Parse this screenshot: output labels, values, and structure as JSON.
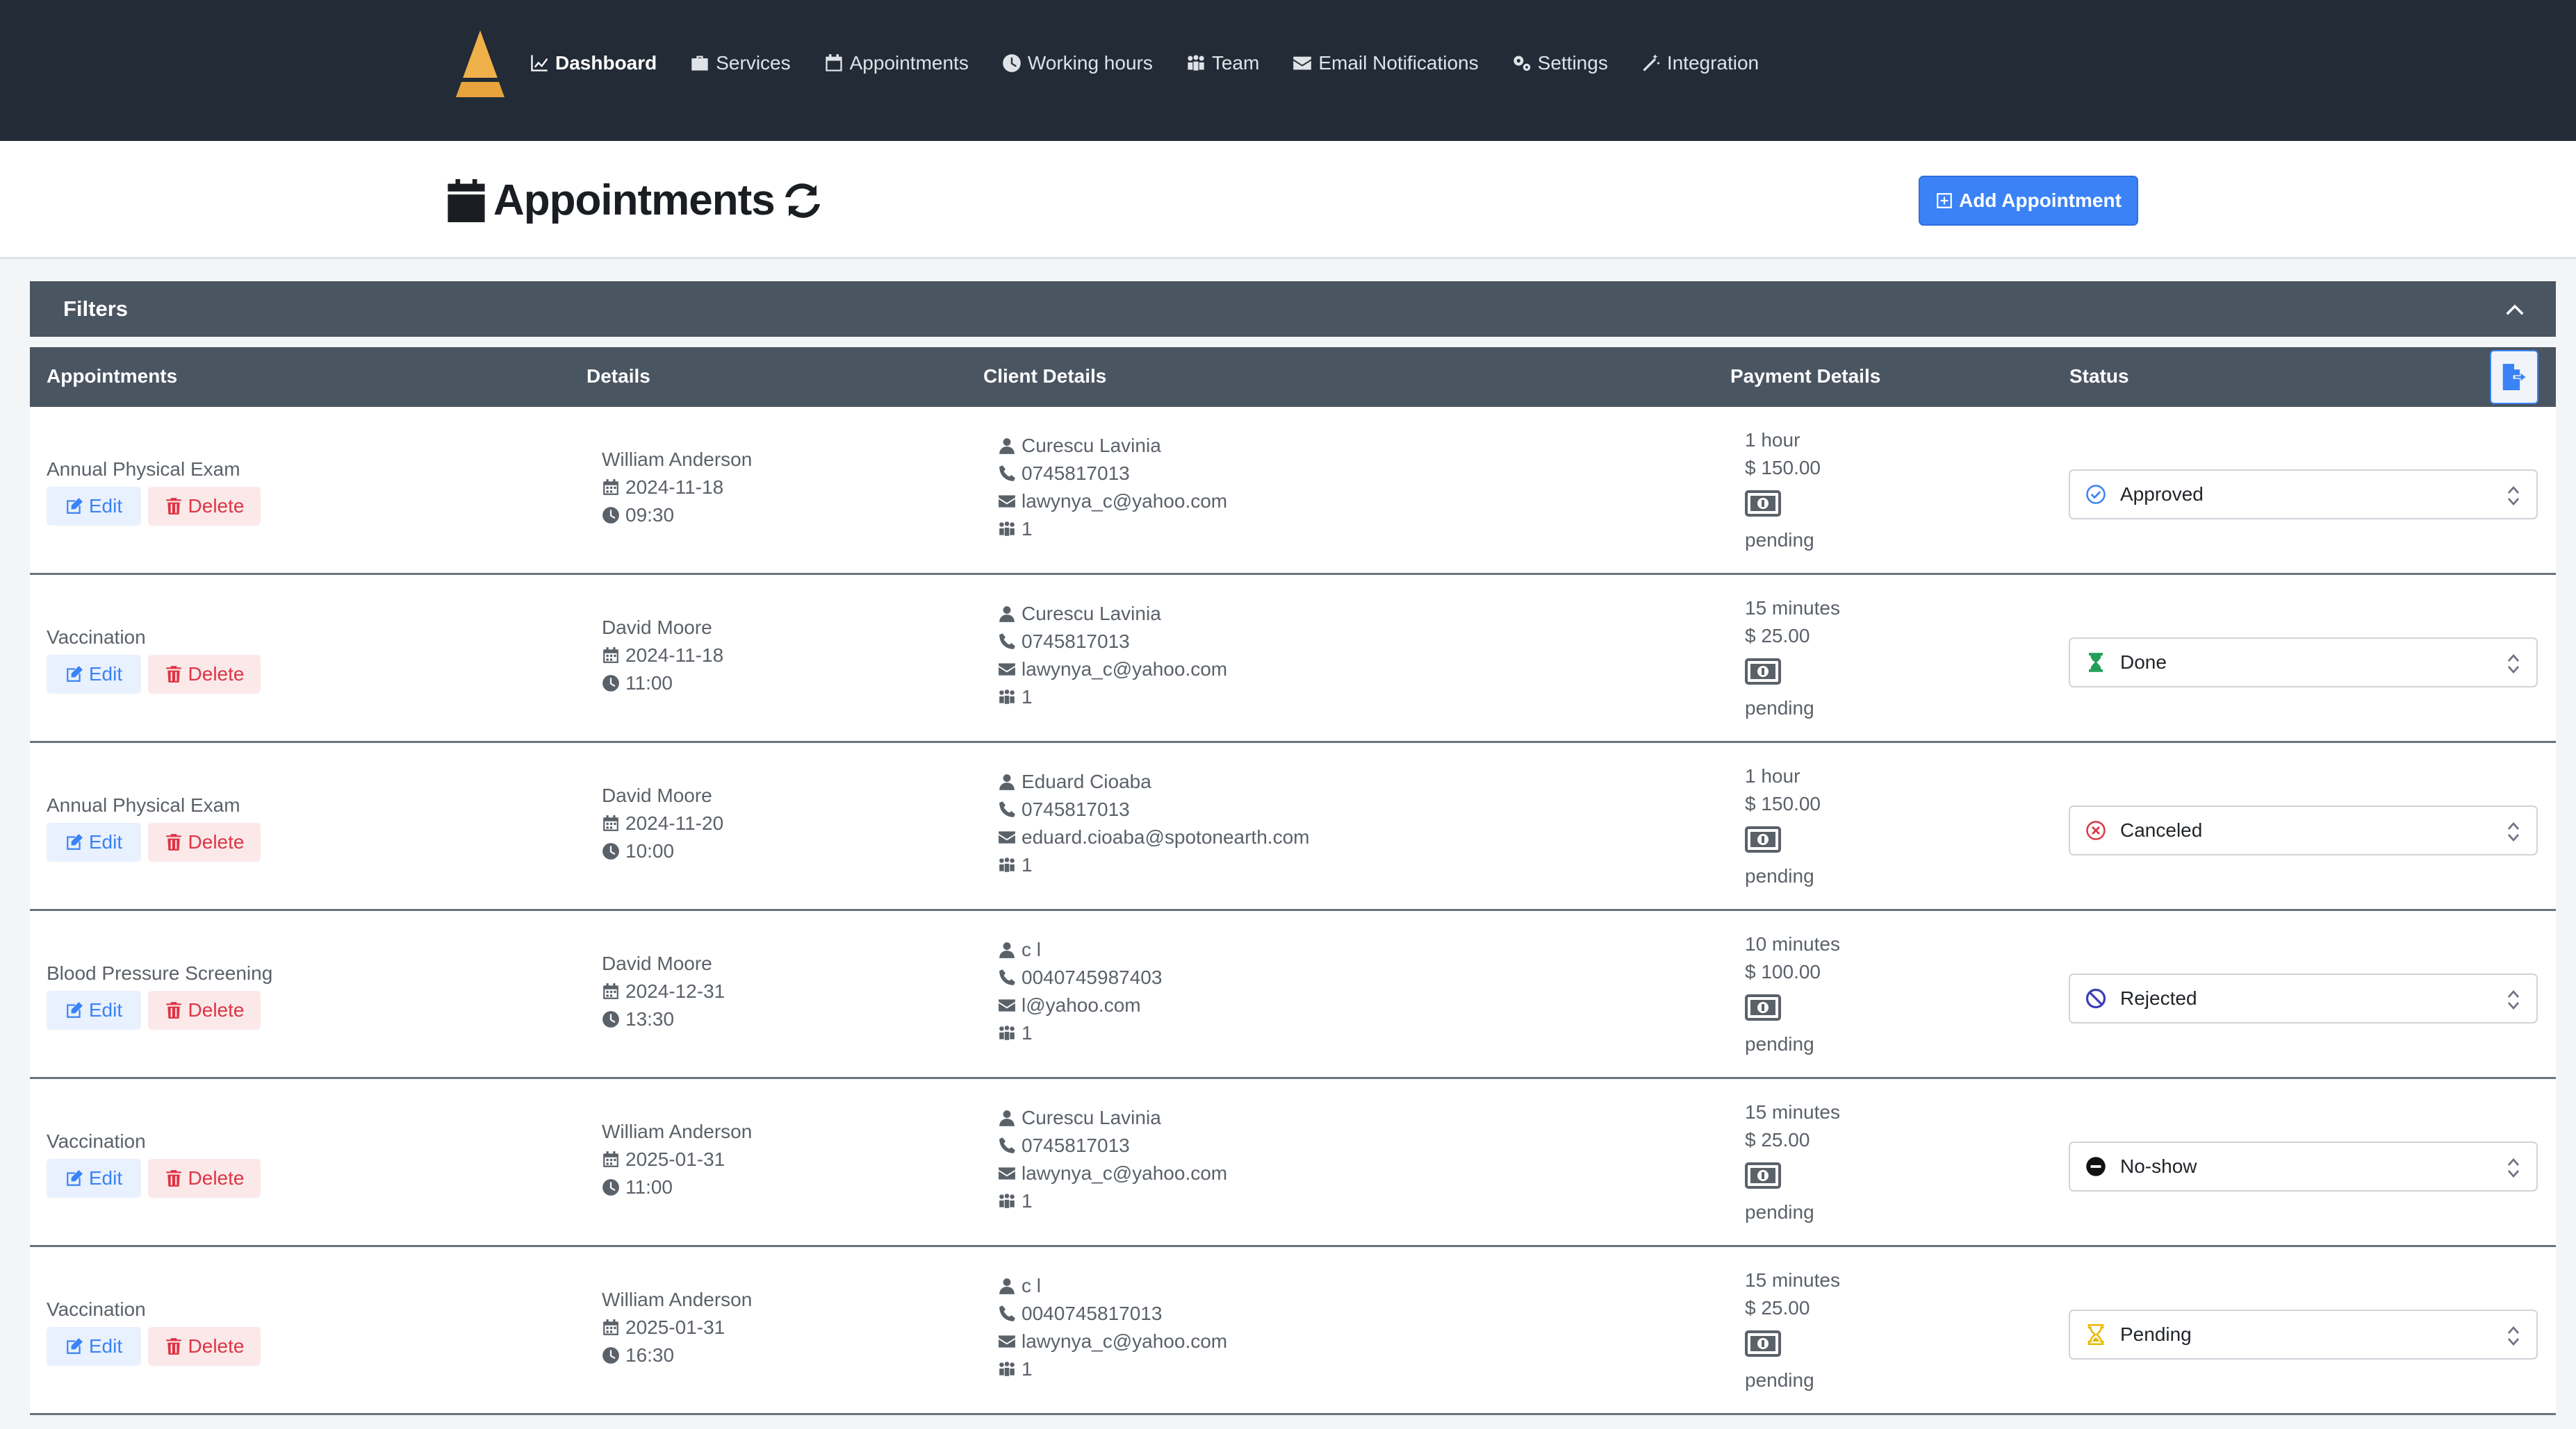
{
  "nav": {
    "items": [
      {
        "label": "Dashboard",
        "icon": "chart-line-icon",
        "active": true
      },
      {
        "label": "Services",
        "icon": "briefcase-icon",
        "active": false
      },
      {
        "label": "Appointments",
        "icon": "calendar-icon",
        "active": false
      },
      {
        "label": "Working hours",
        "icon": "clock-icon",
        "active": false
      },
      {
        "label": "Team",
        "icon": "people-group-icon",
        "active": false
      },
      {
        "label": "Email Notifications",
        "icon": "envelope-icon",
        "active": false
      },
      {
        "label": "Settings",
        "icon": "gears-icon",
        "active": false
      },
      {
        "label": "Integration",
        "icon": "magic-wand-icon",
        "active": false
      }
    ]
  },
  "header": {
    "title": "Appointments",
    "add_button_label": "Add Appointment"
  },
  "filters": {
    "label": "Filters"
  },
  "table": {
    "columns": [
      "Appointments",
      "Details",
      "Client Details",
      "Payment Details",
      "Status"
    ],
    "edit_label": "Edit",
    "delete_label": "Delete",
    "rows": [
      {
        "service": "Annual Physical Exam",
        "staff": "William Anderson",
        "date": "2024-11-18",
        "time": "09:30",
        "client_name": "Curescu Lavinia",
        "phone": "0745817013",
        "email": "lawynya_c@yahoo.com",
        "persons": "1",
        "duration": "1 hour",
        "price": "$ 150.00",
        "payment_status": "pending",
        "status": "Approved",
        "status_icon": "check-circle-icon"
      },
      {
        "service": "Vaccination",
        "staff": "David Moore",
        "date": "2024-11-18",
        "time": "11:00",
        "client_name": "Curescu Lavinia",
        "phone": "0745817013",
        "email": "lawynya_c@yahoo.com",
        "persons": "1",
        "duration": "15 minutes",
        "price": "$ 25.00",
        "payment_status": "pending",
        "status": "Done",
        "status_icon": "hourglass-end-icon"
      },
      {
        "service": "Annual Physical Exam",
        "staff": "David Moore",
        "date": "2024-11-20",
        "time": "10:00",
        "client_name": "Eduard Cioaba",
        "phone": "0745817013",
        "email": "eduard.cioaba@spotonearth.com",
        "persons": "1",
        "duration": "1 hour",
        "price": "$ 150.00",
        "payment_status": "pending",
        "status": "Canceled",
        "status_icon": "x-circle-icon"
      },
      {
        "service": "Blood Pressure Screening",
        "staff": "David Moore",
        "date": "2024-12-31",
        "time": "13:30",
        "client_name": "c l",
        "phone": "0040745987403",
        "email": "l@yahoo.com",
        "persons": "1",
        "duration": "10 minutes",
        "price": "$ 100.00",
        "payment_status": "pending",
        "status": "Rejected",
        "status_icon": "ban-icon"
      },
      {
        "service": "Vaccination",
        "staff": "William Anderson",
        "date": "2025-01-31",
        "time": "11:00",
        "client_name": "Curescu Lavinia",
        "phone": "0745817013",
        "email": "lawynya_c@yahoo.com",
        "persons": "1",
        "duration": "15 minutes",
        "price": "$ 25.00",
        "payment_status": "pending",
        "status": "No-show",
        "status_icon": "minus-circle-icon"
      },
      {
        "service": "Vaccination",
        "staff": "William Anderson",
        "date": "2025-01-31",
        "time": "16:30",
        "client_name": "c l",
        "phone": "0040745817013",
        "email": "lawynya_c@yahoo.com",
        "persons": "1",
        "duration": "15 minutes",
        "price": "$ 25.00",
        "payment_status": "pending",
        "status": "Pending",
        "status_icon": "hourglass-half-icon"
      }
    ]
  },
  "colors": {
    "navbar_bg": "#222b36",
    "accent": "#3b82f6",
    "danger": "#dc3545",
    "table_header_bg": "#4a5562",
    "logo": "#e8a33d",
    "approved": "#3b82f6",
    "done": "#22a05a",
    "canceled": "#dc3545",
    "rejected": "#3d3db8",
    "noshow": "#111111",
    "pending": "#e6b800"
  }
}
